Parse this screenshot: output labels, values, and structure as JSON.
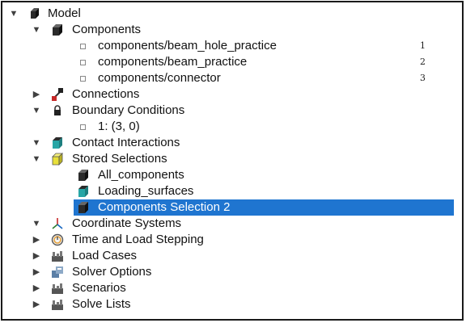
{
  "tree": {
    "root": {
      "label": "Model"
    },
    "components": {
      "label": "Components",
      "children": [
        {
          "label": "components/beam_hole_practice",
          "index": "1"
        },
        {
          "label": "components/beam_practice",
          "index": "2"
        },
        {
          "label": "components/connector",
          "index": "3"
        }
      ]
    },
    "connections": {
      "label": "Connections"
    },
    "boundary_conditions": {
      "label": "Boundary Conditions",
      "children": [
        {
          "label": "1: (3, 0)"
        }
      ]
    },
    "contact_interactions": {
      "label": "Contact Interactions"
    },
    "stored_selections": {
      "label": "Stored Selections",
      "children": [
        {
          "label": "All_components"
        },
        {
          "label": "Loading_surfaces"
        },
        {
          "label": "Components Selection 2",
          "selected": true
        }
      ]
    },
    "coordinate_systems": {
      "label": "Coordinate Systems"
    },
    "time_and_load_stepping": {
      "label": "Time and Load Stepping"
    },
    "load_cases": {
      "label": "Load Cases"
    },
    "solver_options": {
      "label": "Solver Options"
    },
    "scenarios": {
      "label": "Scenarios"
    },
    "solve_lists": {
      "label": "Solve Lists"
    }
  },
  "colors": {
    "selection": "#1f75d0",
    "cube_dark": "#2b2b2b",
    "cube_teal": "#27a6a6",
    "stored_yellow": "#e8e03a"
  }
}
